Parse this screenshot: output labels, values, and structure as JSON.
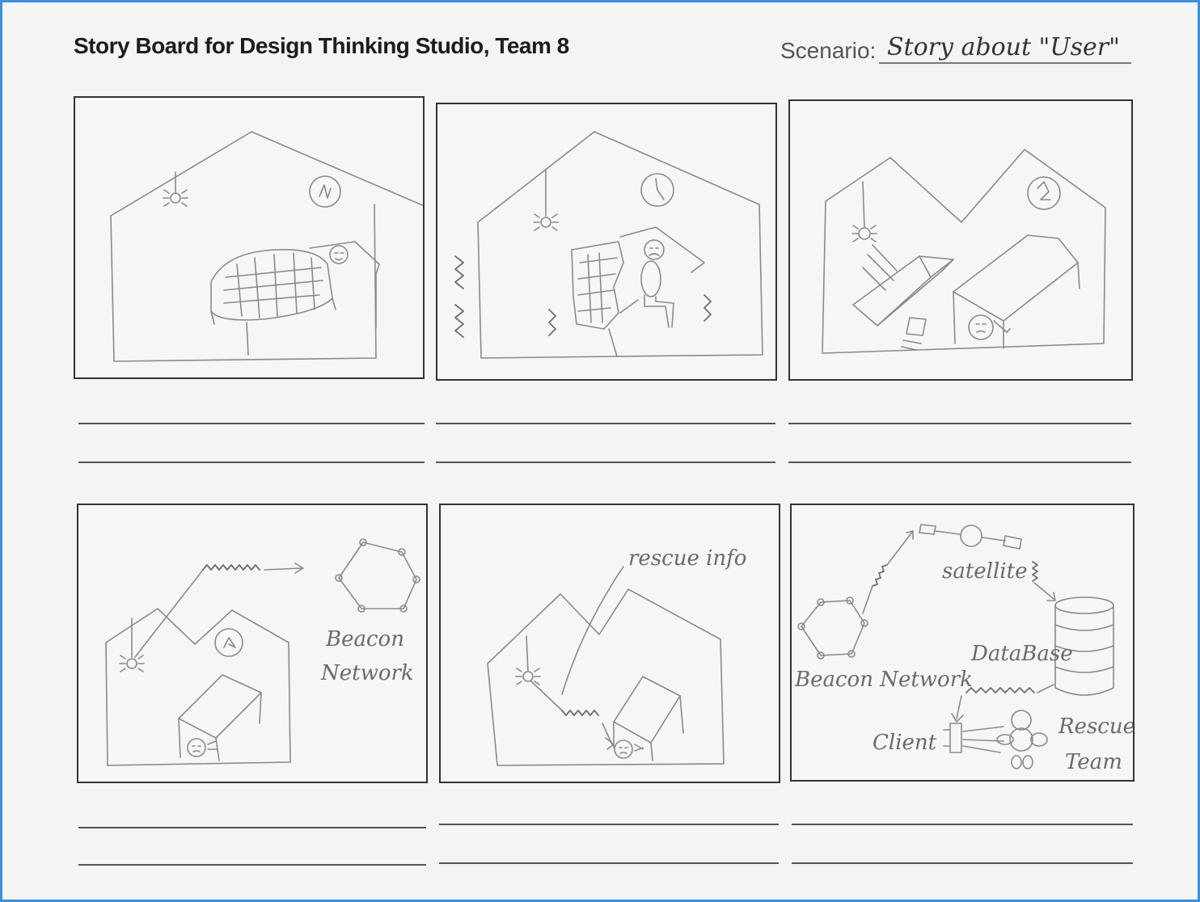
{
  "header": {
    "title": "Story Board for Design Thinking Studio, Team 8",
    "scenario_label": "Scenario:",
    "scenario_value": "Story about \"User\""
  },
  "panels": [
    {
      "id": "p1",
      "scene": "sleeping-in-bed",
      "labels": {}
    },
    {
      "id": "p2",
      "scene": "earthquake-waking",
      "labels": {}
    },
    {
      "id": "p3",
      "scene": "house-collapse-trapped",
      "labels": {}
    },
    {
      "id": "p4",
      "scene": "beacon-signal",
      "labels": {
        "beacon": "Beacon",
        "network": "Network"
      }
    },
    {
      "id": "p5",
      "scene": "rescue-info",
      "labels": {
        "rescue_info": "rescue info"
      }
    },
    {
      "id": "p6",
      "scene": "system-flow",
      "labels": {
        "satellite": "satellite",
        "beacon_network": "Beacon Network",
        "database": "DataBase",
        "client": "Client",
        "rescue": "Rescue",
        "team": "Team"
      }
    }
  ],
  "caption_lines_per_panel": 2,
  "colors": {
    "frame": "#3a8fe0",
    "paper": "#f5f4f2",
    "pencil": "#8a8a8a",
    "ink": "#1c1c1c"
  }
}
